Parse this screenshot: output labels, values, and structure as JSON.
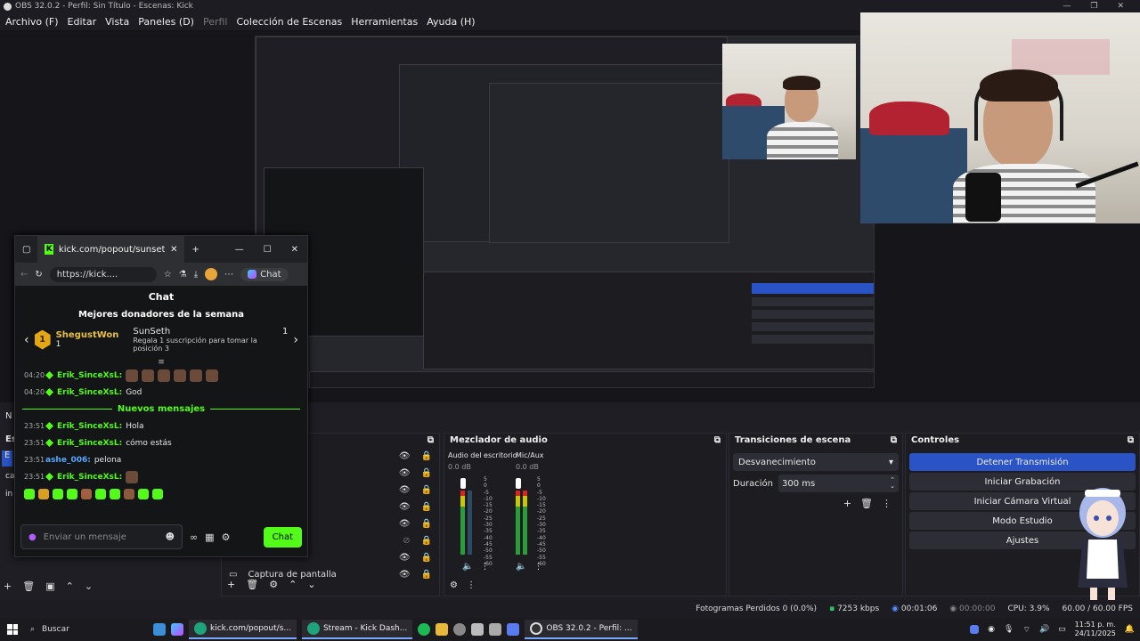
{
  "window": {
    "title": "OBS 32.0.2 - Perfil: Sin Título - Escenas: Kick"
  },
  "menu": {
    "items": [
      "Archivo (F)",
      "Editar",
      "Vista",
      "Paneles (D)",
      "Perfil",
      "Colección de Escenas",
      "Herramientas",
      "Ayuda (H)"
    ]
  },
  "chat_window": {
    "tab_title": "kick.com/popout/sunseth/chat",
    "address": "https://kick....",
    "copilot_label": "Chat",
    "title": "Chat",
    "donors_title": "Mejores donadores de la semana",
    "donor1_name": "ShegustWon",
    "donor1_rank": "1",
    "donor1_count": "1",
    "donor2_name": "SunSeth",
    "donor2_count": "1",
    "gift_hint": "Regala 1 suscripción para tomar la posición 3",
    "new_messages_label": "Nuevos mensajes",
    "messages": [
      {
        "time": "04:20",
        "user": "Erik_SinceXsL:",
        "text": ""
      },
      {
        "time": "04:20",
        "user": "Erik_SinceXsL:",
        "text": "God"
      },
      {
        "time": "23:51",
        "user": "Erik_SinceXsL:",
        "text": "Hola"
      },
      {
        "time": "23:51",
        "user": "Erik_SinceXsL:",
        "text": "cómo estás"
      },
      {
        "time": "23:51",
        "user": "ashe_006:",
        "text": "pelona"
      },
      {
        "time": "23:51",
        "user": "Erik_SinceXsL:",
        "text": ""
      }
    ],
    "input_placeholder": "Enviar un mensaje",
    "send_label": "Chat"
  },
  "docks": {
    "sources_last_item": "Captura de pantalla",
    "mixer_title": "Mezclador de audio",
    "mixer_ch1_name": "Audio del escritorio",
    "mixer_ch1_db": "0.0 dB",
    "mixer_ch2_name": "Mic/Aux",
    "mixer_ch2_db": "0.0 dB",
    "mixer_scale": [
      "5",
      "0",
      "-5",
      "-10",
      "-15",
      "-20",
      "-25",
      "-30",
      "-35",
      "-40",
      "-45",
      "-50",
      "-55",
      "-60"
    ],
    "transitions_title": "Transiciones de escena",
    "transition_value": "Desvanecimiento",
    "duration_label": "Duración",
    "duration_value": "300 ms",
    "controls_title": "Controles",
    "controls": [
      "Detener Transmisión",
      "Iniciar Grabación",
      "Iniciar Cámara Virtual",
      "Modo Estudio",
      "Ajustes"
    ]
  },
  "left_labels": {
    "n": "N",
    "es": "Es",
    "e": "E",
    "ca": "ca",
    "in": "in"
  },
  "status": {
    "dropped_frames": "Fotogramas Perdidos 0 (0.0%)",
    "bitrate": "7253 kbps",
    "stream_time": "00:01:06",
    "rec_time": "00:00:00",
    "cpu": "CPU: 3.9%",
    "fps": "60.00 / 60.00 FPS"
  },
  "taskbar": {
    "search_label": "Buscar",
    "app1": "kick.com/popout/s...",
    "app2": "Stream - Kick Dash...",
    "app3": "OBS 32.0.2 - Perfil: ...",
    "time": "11:51 p. m.",
    "date": "24/11/2025"
  },
  "colors": {
    "kick_green": "#53fc18",
    "obs_accent": "#2a53c5"
  }
}
